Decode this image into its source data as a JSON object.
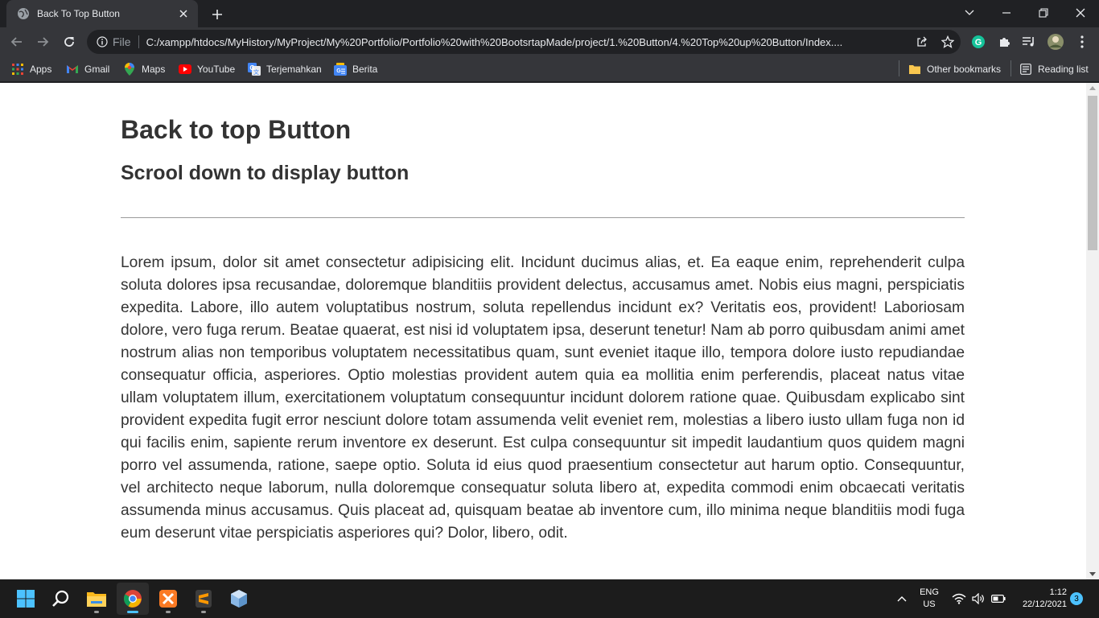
{
  "browser": {
    "tab": {
      "title": "Back To Top Button",
      "favicon": "globe-icon"
    },
    "omnibox": {
      "scheme_label": "File",
      "url": "C:/xampp/htdocs/MyHistory/MyProject/My%20Portfolio/Portfolio%20with%20BootsrtapMade/project/1.%20Button/4.%20Top%20up%20Button/Index...."
    },
    "bookmarks": [
      {
        "label": "Apps",
        "icon": "apps-grid-icon"
      },
      {
        "label": "Gmail",
        "icon": "gmail-icon"
      },
      {
        "label": "Maps",
        "icon": "maps-pin-icon"
      },
      {
        "label": "YouTube",
        "icon": "youtube-icon"
      },
      {
        "label": "Terjemahkan",
        "icon": "translate-icon"
      },
      {
        "label": "Berita",
        "icon": "news-icon"
      }
    ],
    "other_bookmarks": "Other bookmarks",
    "reading_list": "Reading list"
  },
  "page": {
    "heading": "Back to top Button",
    "subheading": "Scrool down to display button",
    "paragraph": "Lorem ipsum, dolor sit amet consectetur adipisicing elit. Incidunt ducimus alias, et. Ea eaque enim, reprehenderit culpa soluta dolores ipsa recusandae, doloremque blanditiis provident delectus, accusamus amet. Nobis eius magni, perspiciatis expedita. Labore, illo autem voluptatibus nostrum, soluta repellendus incidunt ex? Veritatis eos, provident! Laboriosam dolore, vero fuga rerum. Beatae quaerat, est nisi id voluptatem ipsa, deserunt tenetur! Nam ab porro quibusdam animi amet nostrum alias non temporibus voluptatem necessitatibus quam, sunt eveniet itaque illo, tempora dolore iusto repudiandae consequatur officia, asperiores. Optio molestias provident autem quia ea mollitia enim perferendis, placeat natus vitae ullam voluptatem illum, exercitationem voluptatum consequuntur incidunt dolorem ratione quae. Quibusdam explicabo sint provident expedita fugit error nesciunt dolore totam assumenda velit eveniet rem, molestias a libero iusto ullam fuga non id qui facilis enim, sapiente rerum inventore ex deserunt. Est culpa consequuntur sit impedit laudantium quos quidem magni porro vel assumenda, ratione, saepe optio. Soluta id eius quod praesentium consectetur aut harum optio. Consequuntur, vel architecto neque laborum, nulla doloremque consequatur soluta libero at, expedita commodi enim obcaecati veritatis assumenda minus accusamus. Quis placeat ad, quisquam beatae ab inventore cum, illo minima neque blanditiis modi fuga eum deserunt vitae perspiciatis asperiores qui? Dolor, libero, odit."
  },
  "taskbar": {
    "apps": [
      "start-icon",
      "search-icon",
      "file-explorer-icon",
      "chrome-icon",
      "xampp-icon",
      "sublime-text-icon",
      "3d-box-icon"
    ],
    "language": "ENG",
    "region": "US",
    "time": "1:12",
    "date": "22/12/2021",
    "notification_count": "3"
  },
  "colors": {
    "chrome_dark": "#202124",
    "toolbar": "#35363a",
    "page_text": "#333333",
    "accent_blue": "#4cc2ff"
  }
}
